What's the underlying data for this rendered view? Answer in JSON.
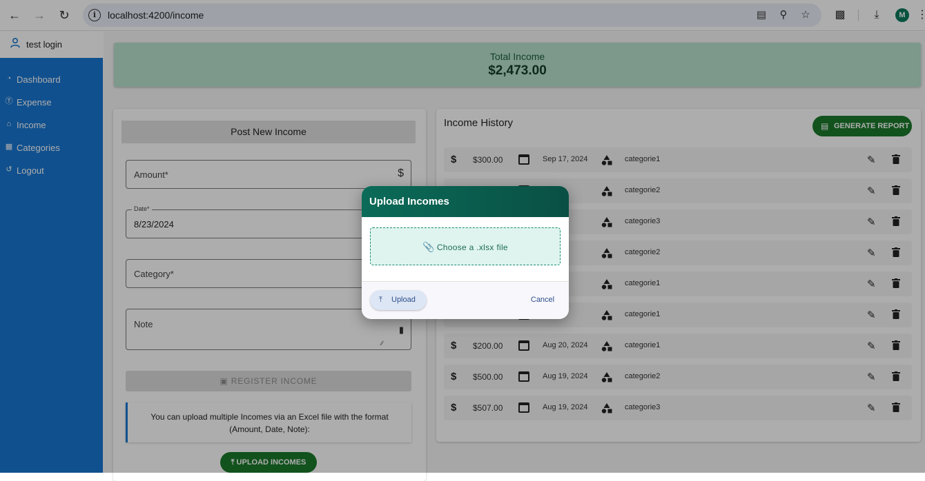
{
  "browser": {
    "url": "localhost:4200/income",
    "profile_initial": "M"
  },
  "user": {
    "name": "test login"
  },
  "sidebar": {
    "items": [
      {
        "label": "Dashboard",
        "icon": "dashboard-icon"
      },
      {
        "label": "Expense",
        "icon": "dollar-circle-icon"
      },
      {
        "label": "Income",
        "icon": "bank-icon"
      },
      {
        "label": "Categories",
        "icon": "grid-icon"
      },
      {
        "label": "Logout",
        "icon": "logout-icon"
      }
    ]
  },
  "total": {
    "label": "Total Income",
    "value": "$2,473.00"
  },
  "form": {
    "title": "Post New Income",
    "amount_label": "Amount*",
    "date_label": "Date*",
    "date_value": "8/23/2024",
    "category_label": "Category*",
    "note_label": "Note",
    "register_label": "REGISTER INCOME",
    "info_text": "You can upload multiple Incomes via an Excel file with the format (Amount, Date, Note):",
    "upload_label": "UPLOAD INCOMES"
  },
  "history": {
    "title": "Income History",
    "report_label": "GENERATE REPORT",
    "rows": [
      {
        "amount": "$300.00",
        "date": "Sep 17, 2024",
        "category": "categorie1"
      },
      {
        "amount": "",
        "date": "2024",
        "category": "categorie2"
      },
      {
        "amount": "",
        "date": "2024",
        "category": "categorie3"
      },
      {
        "amount": "",
        "date": "024",
        "category": "categorie2"
      },
      {
        "amount": "",
        "date": "2024",
        "category": "categorie1"
      },
      {
        "amount": "",
        "date": ", 2024",
        "category": "categorie1"
      },
      {
        "amount": "$200.00",
        "date": "Aug 20, 2024",
        "category": "categorie1"
      },
      {
        "amount": "$500.00",
        "date": "Aug 19, 2024",
        "category": "categorie2"
      },
      {
        "amount": "$507.00",
        "date": "Aug 19, 2024",
        "category": "categorie3"
      }
    ]
  },
  "dialog": {
    "title": "Upload Incomes",
    "dropzone_text": "Choose a .xlsx file",
    "upload_label": "Upload",
    "cancel_label": "Cancel"
  }
}
